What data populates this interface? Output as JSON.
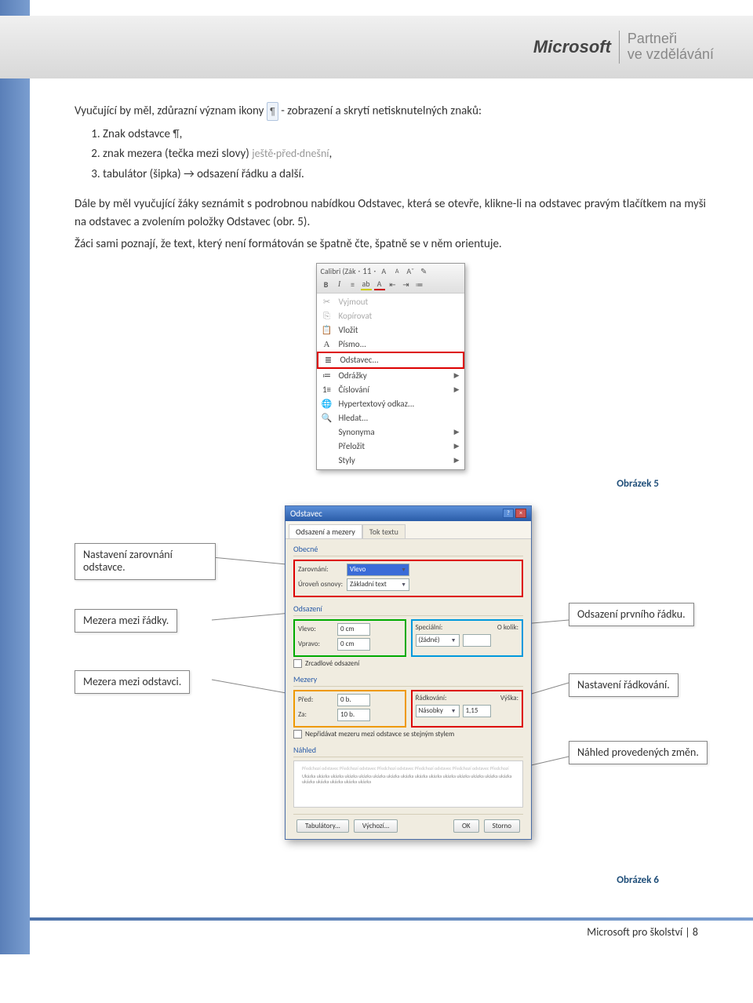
{
  "header": {
    "logo": "Microsoft",
    "subtitle_line1": "Partneři",
    "subtitle_line2": "ve vzdělávání"
  },
  "intro": {
    "para1_a": "Vyučující by měl, zdůrazní význam ikony ",
    "para1_b": " - zobrazení a skrytí netisknutelných znaků:",
    "list": {
      "i1_a": "Znak odstavce ",
      "i1_b": ",",
      "i2_a": "znak mezera (tečka mezi slovy) ",
      "i2_example": "ještě·před·dnešní",
      "i2_b": ",",
      "i3": "tabulátor (šipka) → odsazení řádku a další."
    },
    "para2": "Dále by měl vyučující žáky seznámit s podrobnou nabídkou Odstavec, která se otevře, klikne-li na odstavec pravým tlačítkem na myši na odstavec a zvolením položky Odstavec (obr. 5).",
    "para3": "Žáci sami poznají, že text, který není formátován se špatně čte, špatně se v něm orientuje."
  },
  "fig5": {
    "font": "Calibri (Zák",
    "size": "11",
    "menu": {
      "cut": "Vyjmout",
      "copy": "Kopírovat",
      "paste": "Vložit",
      "font": "Písmo...",
      "paragraph": "Odstavec...",
      "bullets": "Odrážky",
      "numbering": "Číslování",
      "hyperlink": "Hypertextový odkaz...",
      "find": "Hledat...",
      "synonyms": "Synonyma",
      "translate": "Přeložit",
      "styles": "Styly"
    }
  },
  "caption5": "Obrázek 5",
  "fig6": {
    "title": "Odstavec",
    "tabs": {
      "t1": "Odsazení a mezery",
      "t2": "Tok textu"
    },
    "grp_general": "Obecné",
    "lbl_align": "Zarovnání:",
    "val_align": "Vlevo",
    "lbl_level": "Úroveň osnovy:",
    "val_level": "Základní text",
    "grp_indent": "Odsazení",
    "lbl_left": "Vlevo:",
    "val_left": "0 cm",
    "lbl_right": "Vpravo:",
    "val_right": "0 cm",
    "lbl_special": "Speciální:",
    "val_special": "(žádné)",
    "lbl_by": "O kolik:",
    "chk_mirror": "Zrcadlové odsazení",
    "grp_spacing": "Mezery",
    "lbl_before": "Před:",
    "val_before": "0 b.",
    "lbl_after": "Za:",
    "val_after": "10 b.",
    "lbl_linespacing": "Řádkování:",
    "val_linespacing": "Násobky",
    "lbl_at": "Výška:",
    "val_at": "1,15",
    "chk_dontadd": "Nepřidávat mezeru mezi odstavce se stejným stylem",
    "grp_preview": "Náhled",
    "preview_text1": "Předchozí odstavec Předchozí odstavec Předchozí odstavec Předchozí odstavec Předchozí odstavec Předchozí",
    "preview_text2": "Ukázka ukázka ukázka ukázka ukázka ukázka ukázka ukázka ukázka ukázka ukázka ukázka ukázka ukázka ukázka ukázka ukázka ukázka ukázka ukázka",
    "btn_tabs": "Tabulátory...",
    "btn_default": "Výchozí...",
    "btn_ok": "OK",
    "btn_cancel": "Storno"
  },
  "callouts": {
    "c1": "Nastavení zarovnání odstavce.",
    "c2": "Mezera mezi řádky.",
    "c3": "Mezera mezi odstavci.",
    "c4": "Odsazení prvního řádku.",
    "c5": "Nastavení řádkování.",
    "c6": "Náhled provedených změn."
  },
  "caption6": "Obrázek 6",
  "footer": {
    "text_a": "Microsoft pro školství | ",
    "page": "8"
  }
}
